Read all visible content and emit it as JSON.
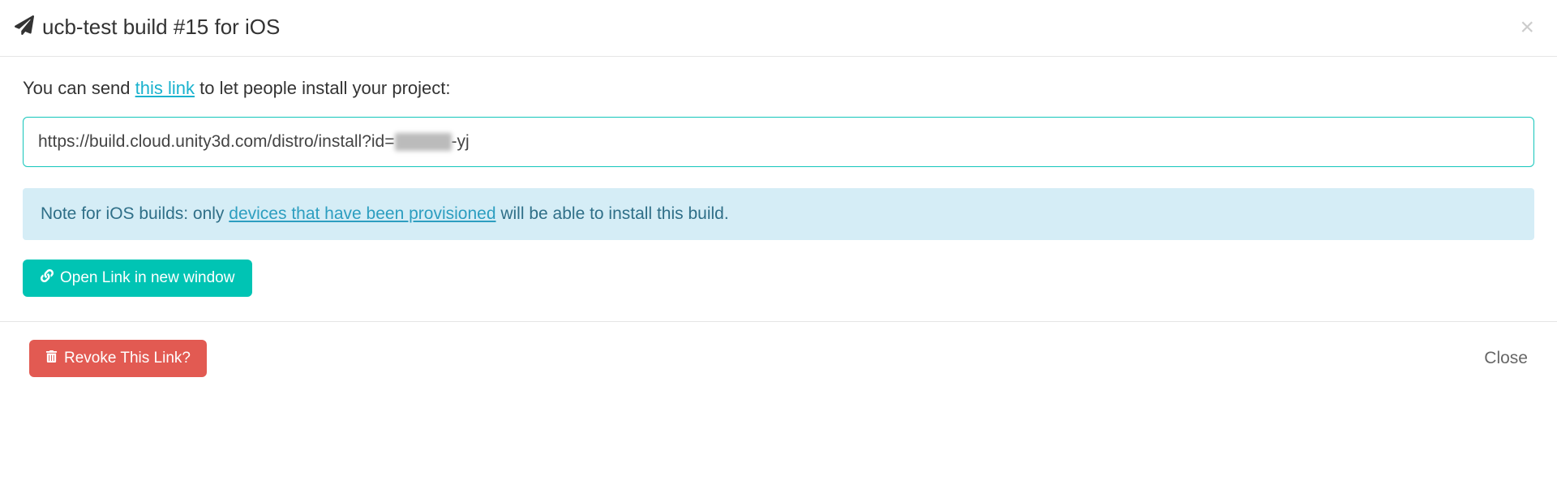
{
  "header": {
    "title": "ucb-test build #15 for iOS"
  },
  "body": {
    "intro_before": "You can send ",
    "intro_link": "this link",
    "intro_after": " to let people install your project:",
    "url_prefix": "https://build.cloud.unity3d.com/distro/install?id=",
    "url_suffix": "-yj",
    "note_prefix": "Note for iOS builds: only ",
    "note_link": "devices that have been provisioned",
    "note_suffix": " will be able to install this build.",
    "open_button": "Open Link in new window"
  },
  "footer": {
    "revoke_button": "Revoke This Link?",
    "close_button": "Close"
  },
  "colors": {
    "accent": "#00c4b4",
    "danger": "#e25a52",
    "link": "#1ab2ce"
  }
}
